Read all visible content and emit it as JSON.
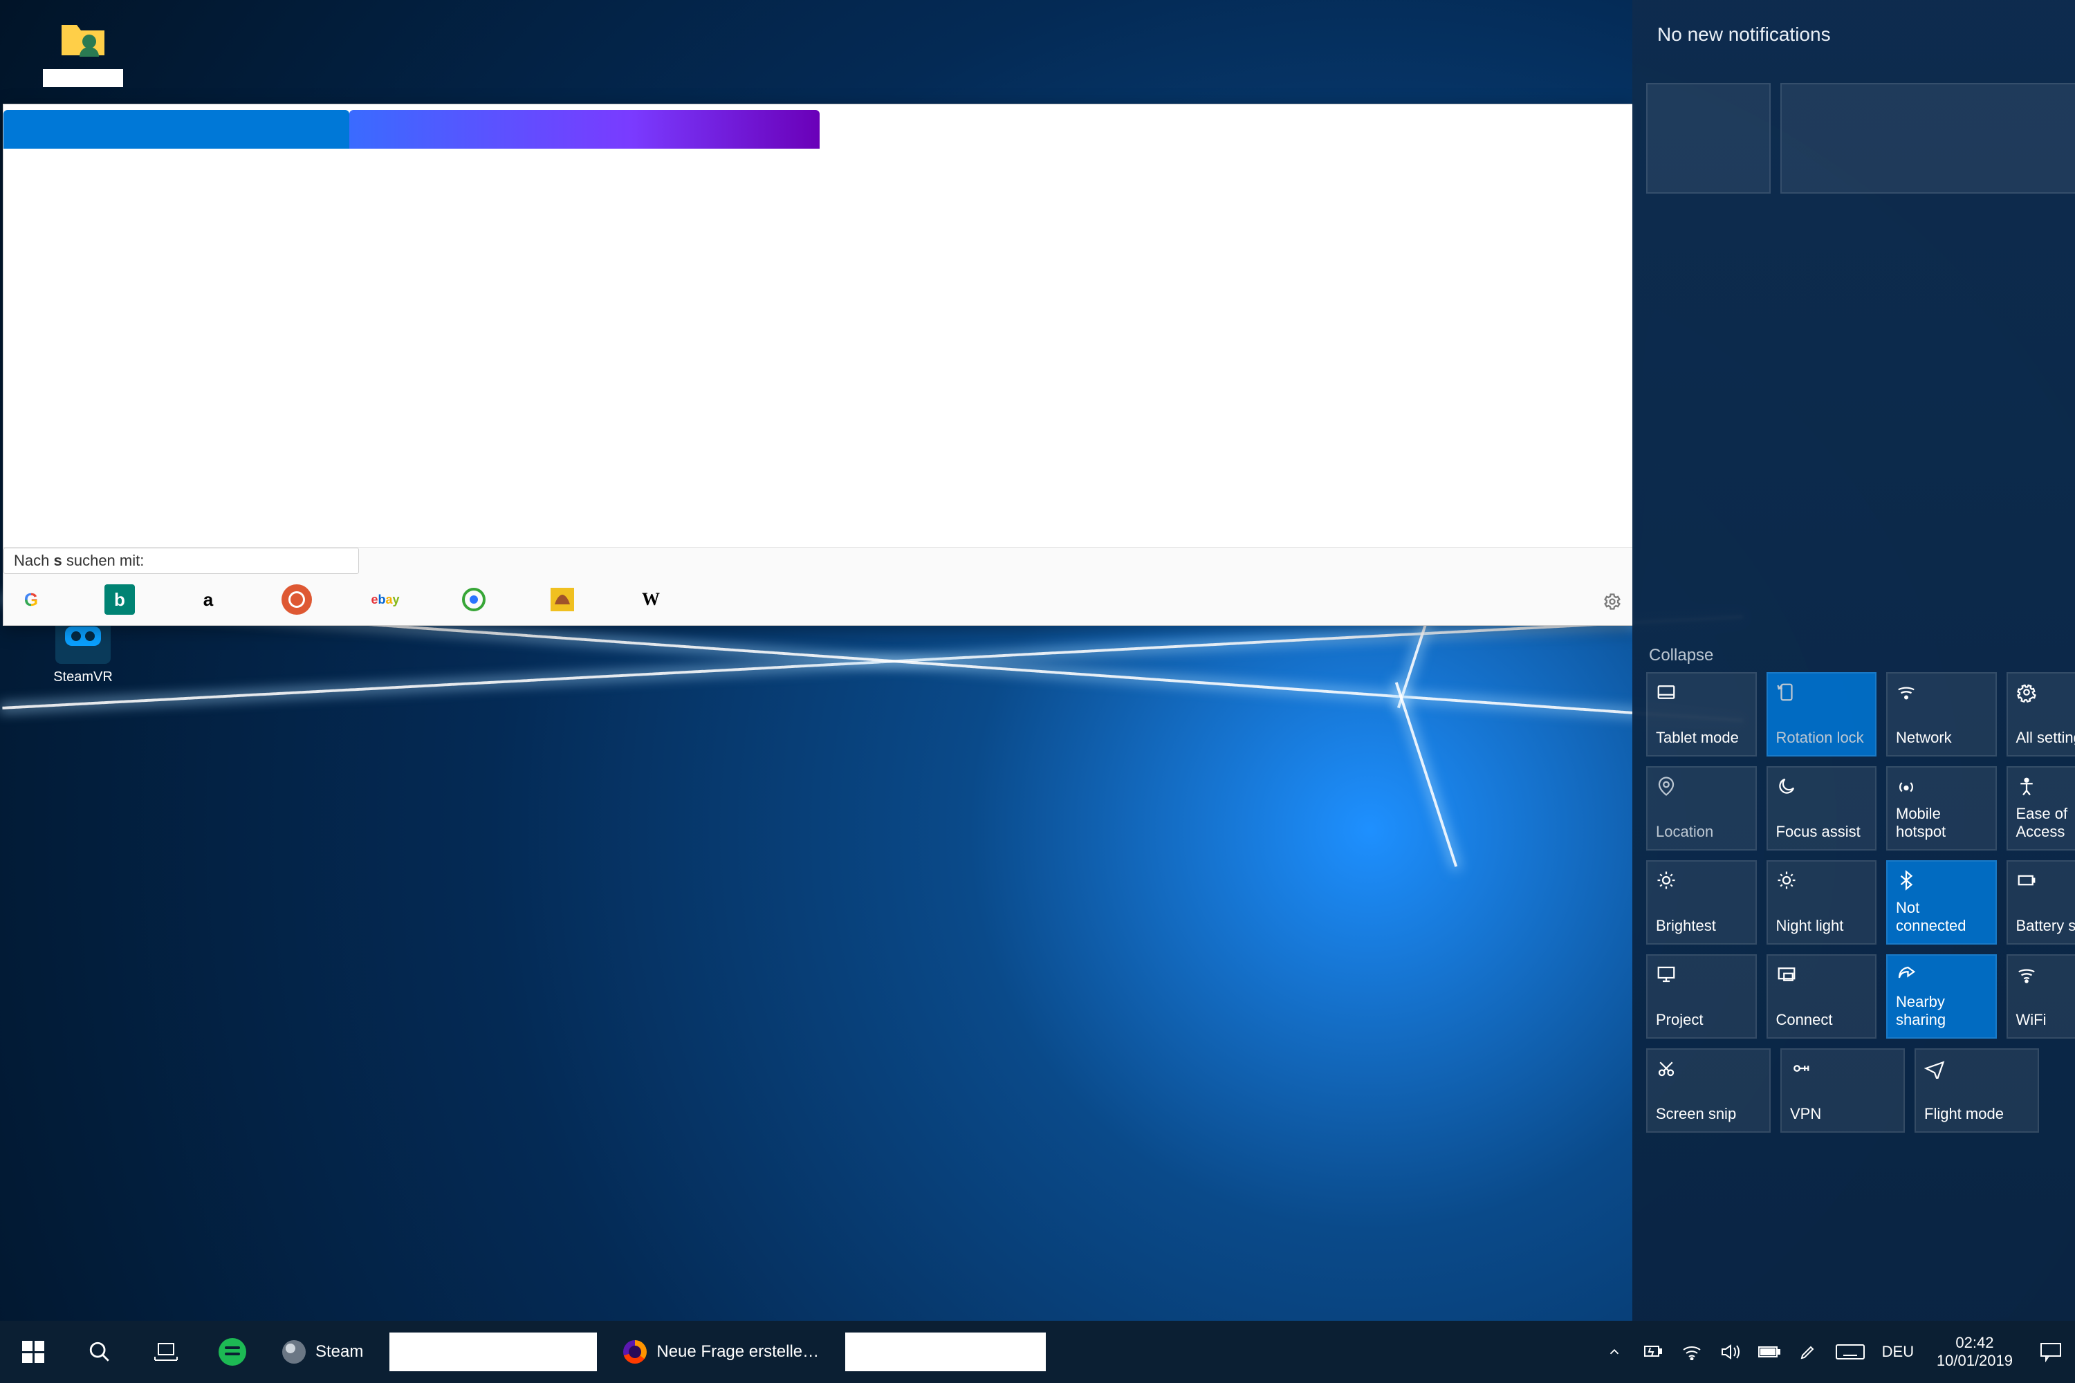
{
  "desktop_icons": {
    "user_folder": {
      "name": "user-folder",
      "label": ""
    },
    "steamvr": {
      "name": "steamvr",
      "label": "SteamVR"
    }
  },
  "browser": {
    "tabs": [
      {
        "title": "",
        "active": true
      },
      {
        "title": "",
        "active": false
      }
    ],
    "suggest_prefix": "Nach ",
    "suggest_query": "s",
    "suggest_suffix": " suchen mit:",
    "engines": [
      "Google",
      "Bing",
      "Amazon",
      "DuckDuckGo",
      "eBay",
      "Ecosia",
      "LEO",
      "Wikipedia"
    ]
  },
  "action_center": {
    "header": "No new notifications",
    "collapse": "Collapse",
    "tiles": [
      [
        {
          "label": "Tablet mode",
          "icon": "tablet",
          "state": "normal"
        },
        {
          "label": "Rotation lock",
          "icon": "rotation",
          "state": "active-muted"
        },
        {
          "label": "Network",
          "icon": "network",
          "state": "normal"
        },
        {
          "label": "All settings",
          "icon": "gear",
          "state": "normal"
        }
      ],
      [
        {
          "label": "Location",
          "icon": "location",
          "state": "muted"
        },
        {
          "label": "Focus assist",
          "icon": "moon",
          "state": "normal"
        },
        {
          "label": "Mobile hotspot",
          "icon": "hotspot",
          "state": "normal"
        },
        {
          "label": "Ease of Access",
          "icon": "ease",
          "state": "normal"
        }
      ],
      [
        {
          "label": "Brightest",
          "icon": "sun",
          "state": "normal"
        },
        {
          "label": "Night light",
          "icon": "sun",
          "state": "normal"
        },
        {
          "label": "Not connected",
          "icon": "bluetooth",
          "state": "active"
        },
        {
          "label": "Battery saver",
          "icon": "battery",
          "state": "normal"
        }
      ],
      [
        {
          "label": "Project",
          "icon": "project",
          "state": "normal"
        },
        {
          "label": "Connect",
          "icon": "connect",
          "state": "normal"
        },
        {
          "label": "Nearby sharing",
          "icon": "share",
          "state": "active"
        },
        {
          "label": "WiFi",
          "icon": "wifi",
          "state": "normal"
        }
      ],
      [
        {
          "label": "Screen snip",
          "icon": "snip",
          "state": "normal"
        },
        {
          "label": "VPN",
          "icon": "vpn",
          "state": "normal"
        },
        {
          "label": "Flight mode",
          "icon": "plane",
          "state": "normal"
        }
      ]
    ]
  },
  "taskbar": {
    "apps": {
      "steam": "Steam",
      "firefox": "Neue Frage erstelle…"
    },
    "tray": {
      "lang": "DEU",
      "time": "02:42",
      "date": "10/01/2019"
    }
  }
}
